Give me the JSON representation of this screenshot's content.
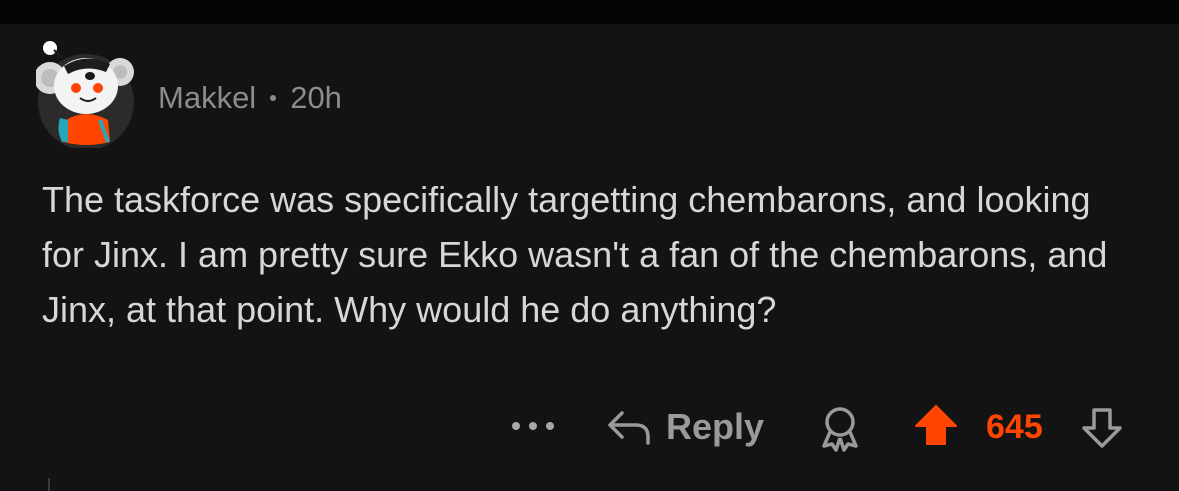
{
  "comment": {
    "username": "Makkel",
    "timestamp": "20h",
    "body": "The taskforce was specifically targetting chembarons, and looking for Jinx. I am pretty sure Ekko wasn't a fan of the chembarons, and Jinx, at that point. Why would he do anything?",
    "avatar_icon": "snoo-koala-avatar"
  },
  "actions": {
    "more_icon": "ellipsis-icon",
    "reply_label": "Reply",
    "reply_icon": "reply-arrow-icon",
    "award_icon": "award-icon",
    "upvote_icon": "upvote-arrow-icon",
    "upvote_state": "upvoted",
    "vote_count": "645",
    "downvote_icon": "downvote-arrow-icon"
  },
  "colors": {
    "background": "#131313",
    "text": "#d7d7d7",
    "meta": "#8c8c8c",
    "upvote": "#ff4500"
  }
}
